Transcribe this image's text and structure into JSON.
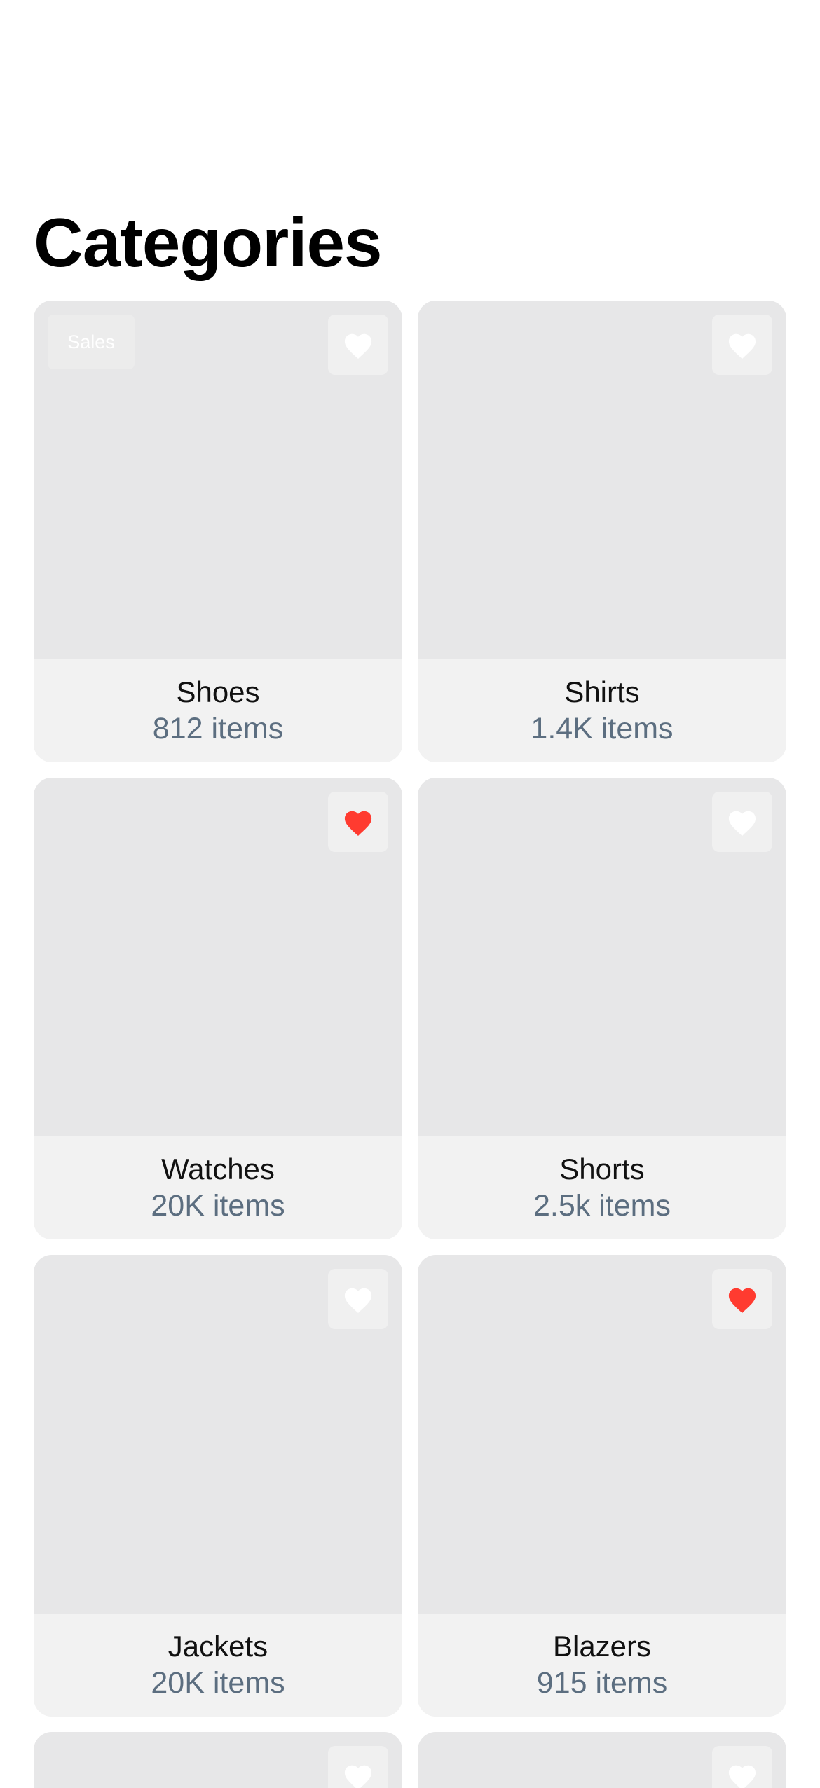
{
  "header": {
    "title": "Categories"
  },
  "colors": {
    "card_image": "#e7e7e8",
    "card_footer": "#f2f2f2",
    "count_text": "#5c6e80",
    "heart_active": "#ff3b30",
    "heart_inactive": "#ffffff"
  },
  "categories": [
    {
      "name": "Shoes",
      "count": "812 items",
      "badge": "Sales",
      "favorite": false
    },
    {
      "name": "Shirts",
      "count": "1.4K items",
      "badge": "",
      "favorite": false
    },
    {
      "name": "Watches",
      "count": "20K items",
      "badge": "",
      "favorite": true
    },
    {
      "name": "Shorts",
      "count": "2.5k items",
      "badge": "",
      "favorite": false
    },
    {
      "name": "Jackets",
      "count": "20K items",
      "badge": "",
      "favorite": false
    },
    {
      "name": "Blazers",
      "count": "915 items",
      "badge": "",
      "favorite": true
    },
    {
      "name": "",
      "count": "",
      "badge": "",
      "favorite": false
    },
    {
      "name": "",
      "count": "",
      "badge": "",
      "favorite": false
    }
  ],
  "icons": {
    "favorite": "heart-icon"
  }
}
